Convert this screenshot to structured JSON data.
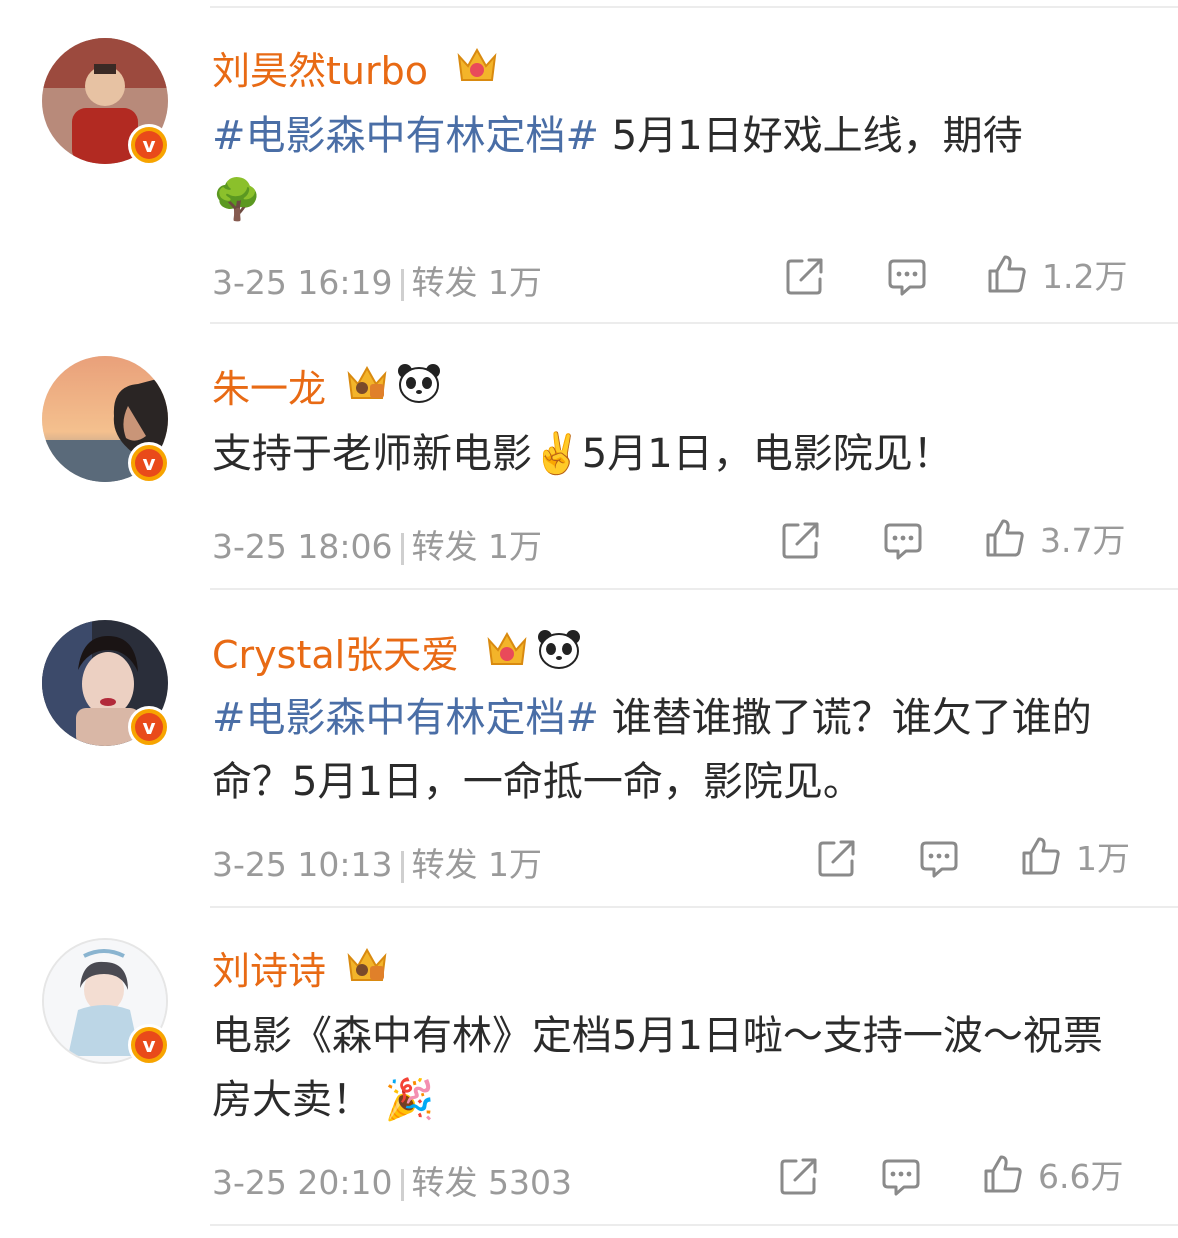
{
  "posts": [
    {
      "author": "刘昊然turbo",
      "hashtag": "#电影森中有林定档#",
      "text_main": " 5月1日好戏上线，期待",
      "text_emoji": "🌳",
      "time": "3-25 16:19",
      "repost_label": "转发",
      "repost_count": "1万",
      "like_count": "1.2万",
      "badges": [
        "crown-badge-icon"
      ]
    },
    {
      "author": "朱一龙",
      "hashtag": "",
      "text_main": "支持于老师新电影✌️5月1日，电影院见！",
      "text_emoji": "",
      "time": "3-25 18:06",
      "repost_label": "转发",
      "repost_count": "1万",
      "like_count": "3.7万",
      "badges": [
        "crown-badge-icon",
        "panda-icon"
      ]
    },
    {
      "author": "Crystal张天爱",
      "hashtag": "#电影森中有林定档#",
      "text_main": " 谁替谁撒了谎？谁欠了谁的命？5月1日，一命抵一命，影院见。",
      "text_emoji": "",
      "time": "3-25 10:13",
      "repost_label": "转发",
      "repost_count": "1万",
      "like_count": "1万",
      "badges": [
        "crown-badge-icon",
        "panda-icon"
      ]
    },
    {
      "author": "刘诗诗",
      "hashtag": "",
      "text_main": "电影《森中有林》定档5月1日啦～支持一波～祝票房大卖！",
      "text_emoji": "🎉",
      "time": "3-25 20:10",
      "repost_label": "转发",
      "repost_count": "5303",
      "like_count": "6.6万",
      "badges": [
        "crown-badge-icon"
      ]
    }
  ],
  "verified_badge": "v",
  "colors": {
    "name": "#e86a14",
    "hashtag": "#4a6ea6",
    "text": "#2b2b2b",
    "meta": "#9a9a9a",
    "verified": "#f7a400"
  }
}
